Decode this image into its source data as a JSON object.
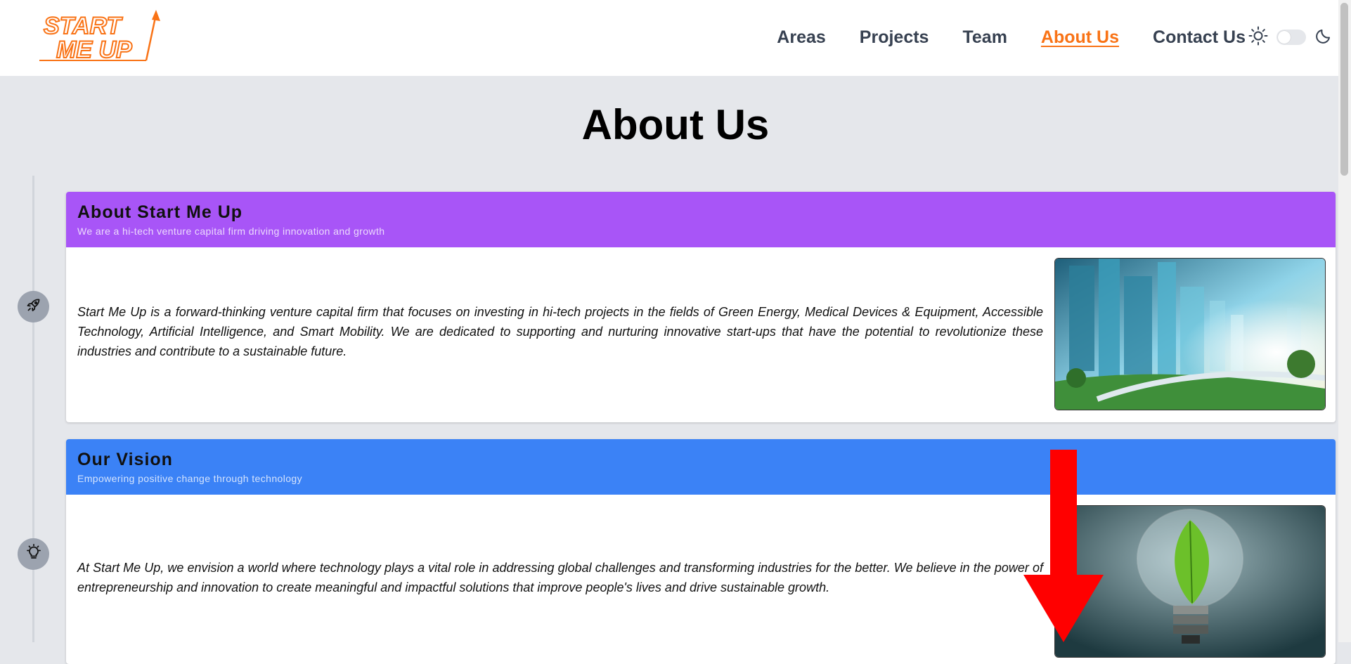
{
  "header": {
    "logo_text_line1": "START",
    "logo_text_line2": "ME UP",
    "nav": [
      {
        "label": "Areas"
      },
      {
        "label": "Projects"
      },
      {
        "label": "Team"
      },
      {
        "label": "About Us",
        "active": true
      },
      {
        "label": "Contact Us"
      }
    ],
    "theme_toggle": {
      "light_icon": "sun-icon",
      "dark_icon": "moon-icon",
      "state": "light"
    }
  },
  "main": {
    "title": "About Us",
    "sections": [
      {
        "title": "About Start Me Up",
        "subtitle": "We are a hi-tech venture capital firm driving innovation and growth",
        "text": "Start Me Up is a forward-thinking venture capital firm that focuses on investing in hi-tech projects in the fields of Green Energy, Medical Devices & Equipment, Accessible Technology, Artificial Intelligence, and Smart Mobility. We are dedicated to supporting and nurturing innovative start-ups that have the potential to revolutionize these industries and contribute to a sustainable future.",
        "icon": "rocket-icon",
        "color": "#a855f7",
        "image": "futuristic-city-image"
      },
      {
        "title": "Our Vision",
        "subtitle": "Empowering positive change through technology",
        "text": "At Start Me Up, we envision a world where technology plays a vital role in addressing global challenges and transforming industries for the better. We believe in the power of entrepreneurship and innovation to create meaningful and impactful solutions that improve people's lives and drive sustainable growth.",
        "icon": "lightbulb-icon",
        "color": "#3b82f6",
        "image": "lightbulb-leaf-image"
      }
    ]
  },
  "colors": {
    "accent": "#f97316",
    "page_bg": "#e5e7eb",
    "arrow": "#ff0000"
  }
}
